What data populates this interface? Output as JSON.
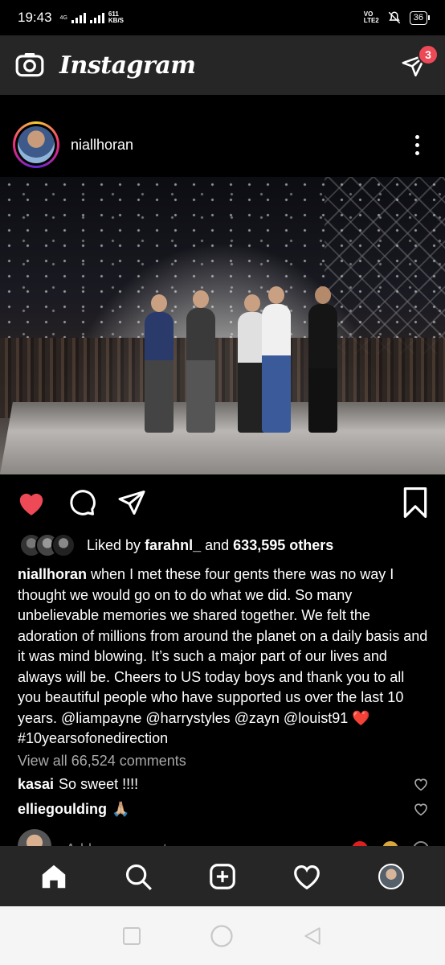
{
  "status_bar": {
    "time": "19:43",
    "network": "4G",
    "speed_value": "611",
    "speed_unit": "KB/S",
    "volte_top": "VO",
    "volte_bottom": "LTE2",
    "battery": "36"
  },
  "app": {
    "wordmark": "Instagram",
    "dm_badge_count": "3",
    "camera_icon": "camera-icon",
    "dm_icon": "direct-message-icon"
  },
  "post": {
    "username": "niallhoran",
    "image_icon": "concert-photo",
    "actions": {
      "like_state": "liked",
      "like_color": "#ed4956"
    },
    "likes": {
      "prefix": "Liked by",
      "liker": "farahnl_",
      "and": "and",
      "others": "633,595 others"
    },
    "caption": {
      "author": "niallhoran",
      "text": "when I met these four gents there was no way I thought we would go on to do what we did. So many unbelievable memories we shared together. We felt the adoration of millions from around the planet on a daily basis and it was mind blowing. It’s such a major part of our lives and always will be. Cheers to US today boys and thank you to all you beautiful people who have supported us over the last 10 years. @liampayne @harrystyles @zayn @louist91",
      "emoji": "❤️",
      "hashtag": "#10yearsofonedirection"
    },
    "view_all_comments": "View all 66,524 comments",
    "comments": [
      {
        "user": "kasai",
        "text": "So sweet !!!!"
      },
      {
        "user": "elliegoulding",
        "text": "🙏🏼"
      }
    ],
    "add_comment_placeholder": "Add a comment..."
  },
  "bottom_nav": {
    "items": [
      "home-icon",
      "search-icon",
      "new-post-icon",
      "activity-icon",
      "profile-avatar"
    ],
    "active": "home-icon"
  },
  "system_nav": {
    "items": [
      "recents-button",
      "home-button",
      "back-button"
    ]
  },
  "colors": {
    "accent_red": "#ed4956",
    "bar_background": "#262626",
    "muted_text": "#a8a8a8"
  }
}
